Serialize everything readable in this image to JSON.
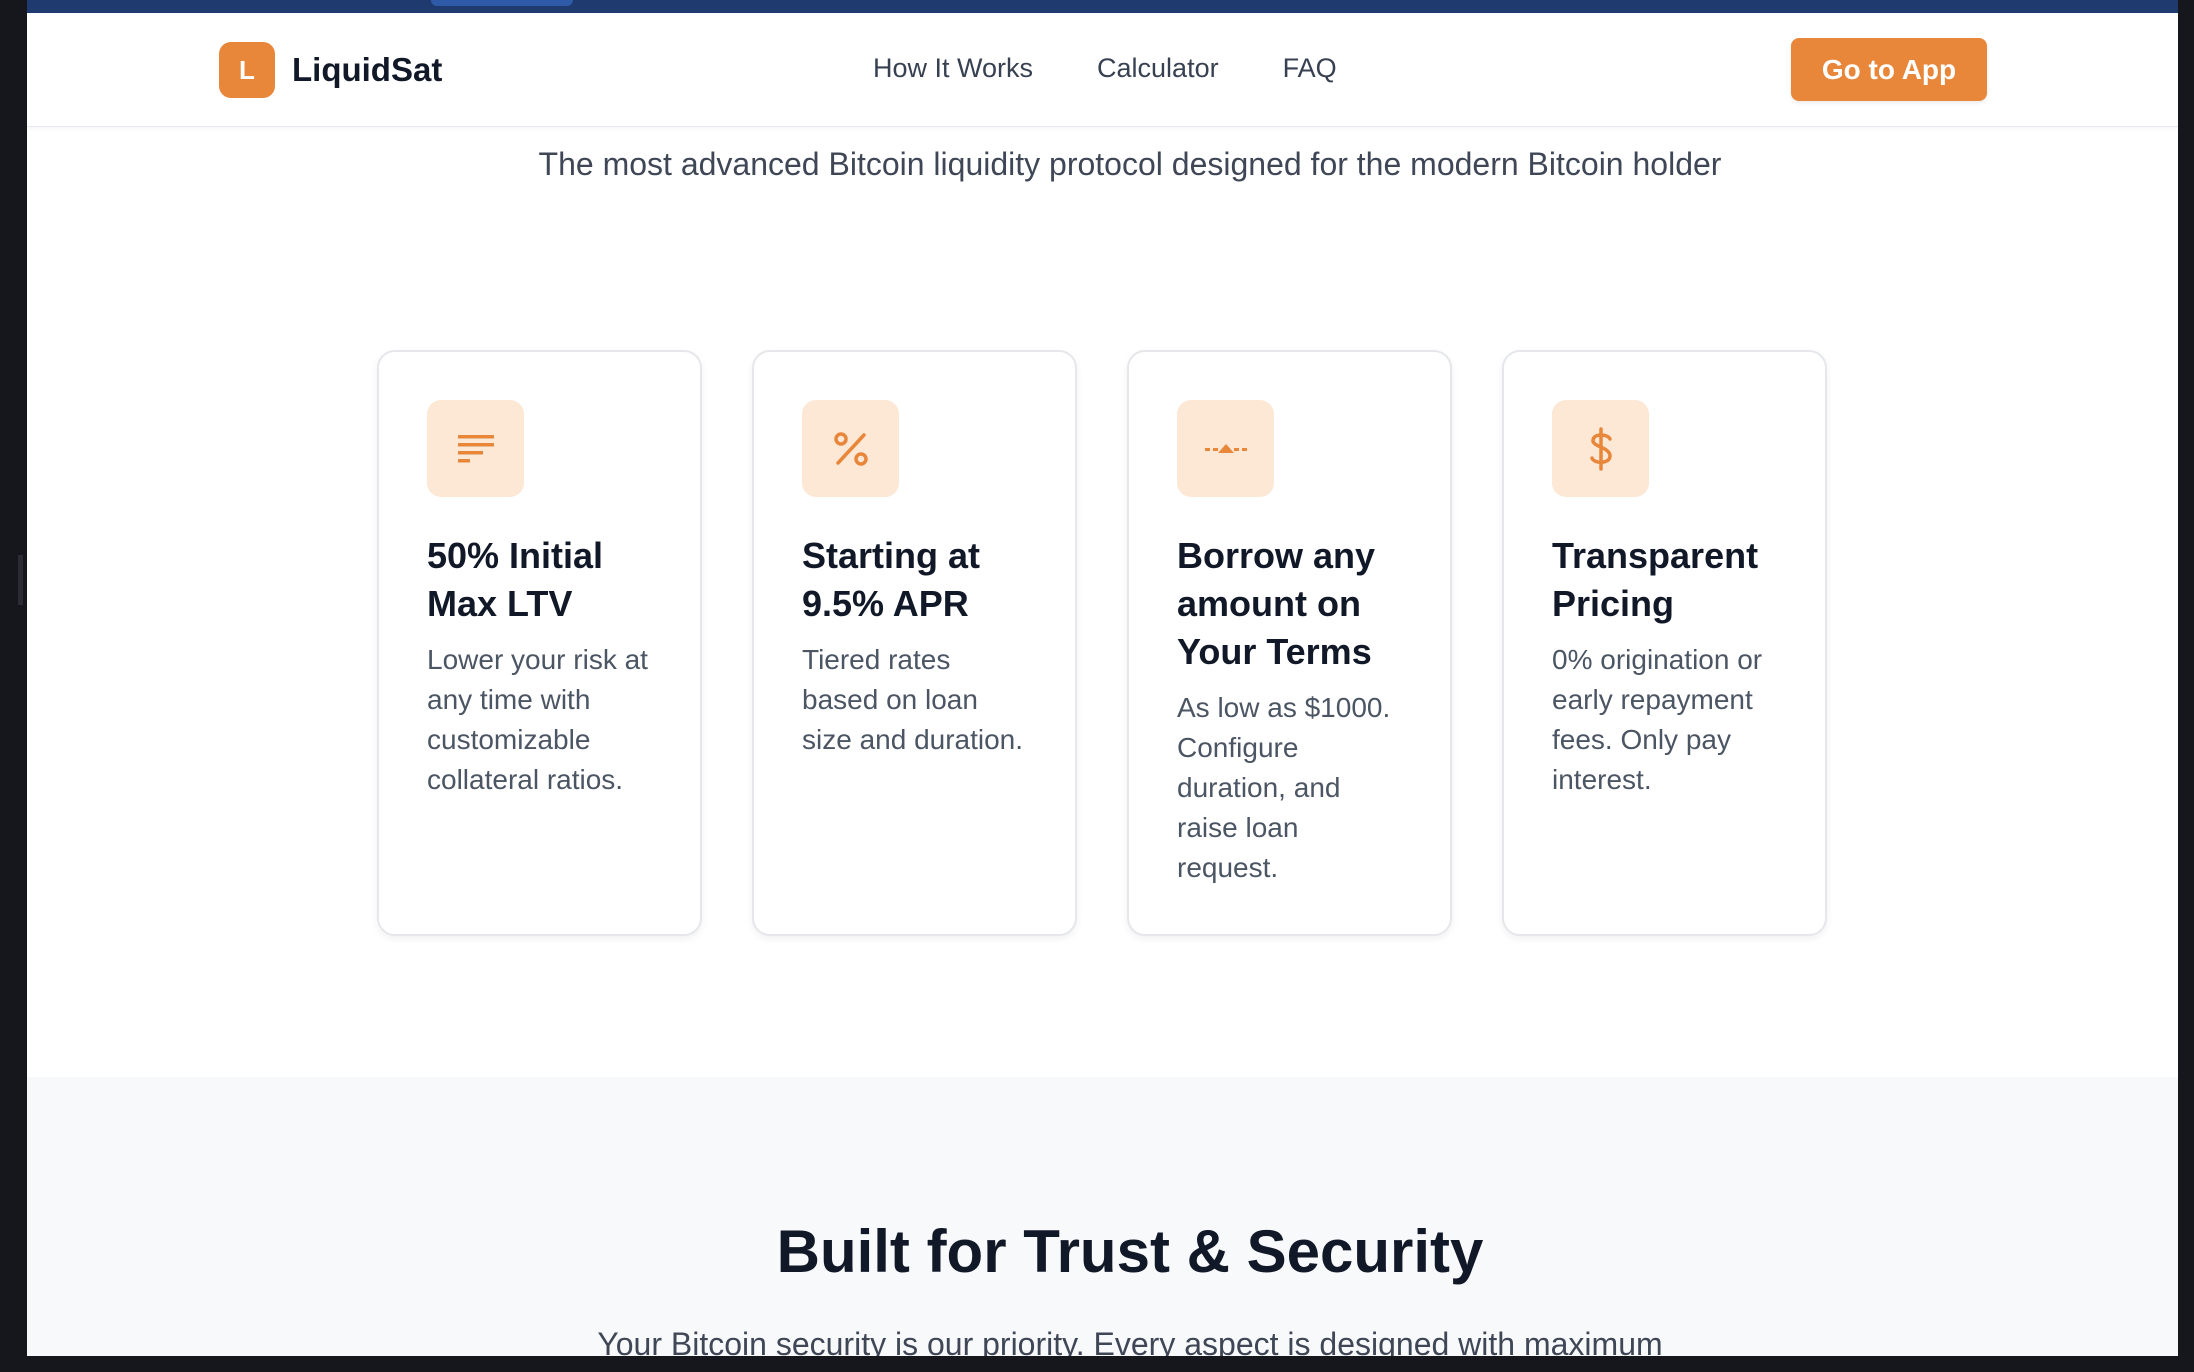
{
  "brand": {
    "badge_letter": "L",
    "name": "LiquidSat",
    "accent_color": "#e8863a"
  },
  "nav": {
    "links": [
      "How It Works",
      "Calculator",
      "FAQ"
    ],
    "cta_label": "Go to App"
  },
  "hero": {
    "subtitle": "The most advanced Bitcoin liquidity protocol designed for the modern Bitcoin holder"
  },
  "features": [
    {
      "icon": "bars-icon",
      "title": "50% Initial Max LTV",
      "description": "Lower your risk at any time with customizable collateral ratios."
    },
    {
      "icon": "percent-icon",
      "title": "Starting at 9.5% APR",
      "description": "Tiered rates based on loan size and duration."
    },
    {
      "icon": "arrow-up-icon",
      "title": "Borrow any amount on Your Terms",
      "description": "As low as $1000. Configure duration, and raise loan request."
    },
    {
      "icon": "dollar-icon",
      "title": "Transparent Pricing",
      "description": "0% origination or early repayment fees. Only pay interest."
    }
  ],
  "trust_section": {
    "heading": "Built for Trust & Security",
    "text": "Your Bitcoin security is our priority. Every aspect is designed with maximum"
  }
}
